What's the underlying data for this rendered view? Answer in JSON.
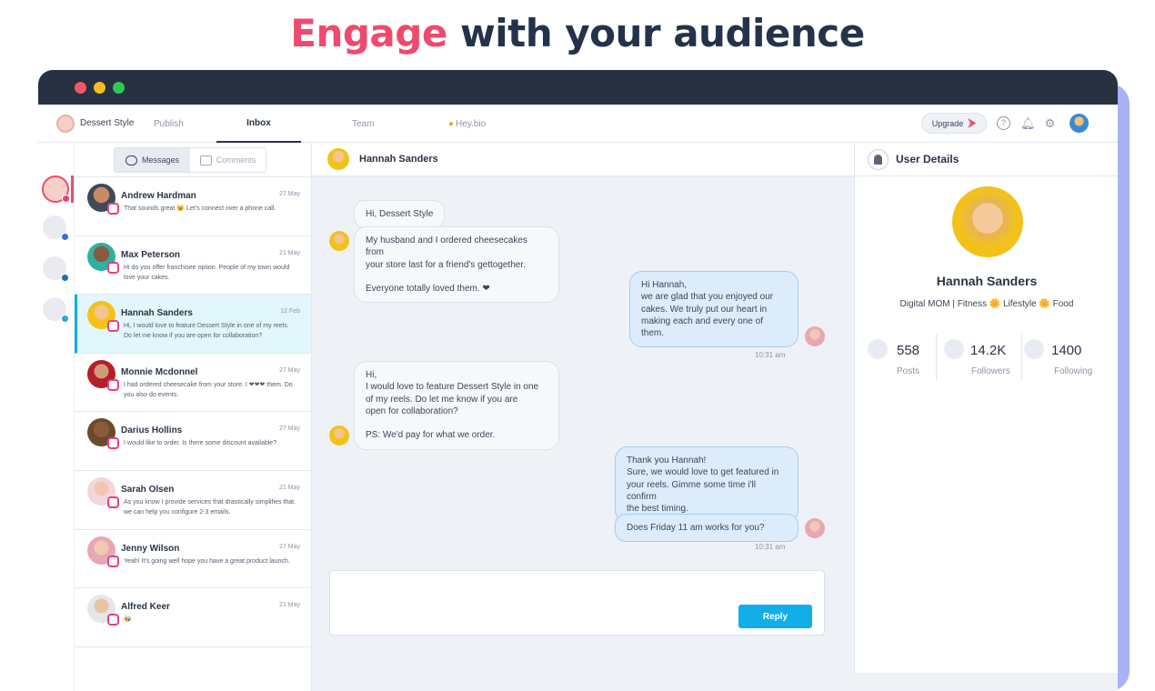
{
  "headline": {
    "accent": "Engage",
    "rest": "with your audience"
  },
  "colors": {
    "accent": "#ef4a6e",
    "brand_blue": "#11aee8",
    "dark": "#28313f"
  },
  "nav": {
    "brand": "Dessert Style",
    "items": [
      "Publish",
      "Inbox",
      "Team",
      "Hey.bio"
    ],
    "active": "Inbox",
    "upgrade": "Upgrade",
    "icons": [
      "help-icon",
      "bell-icon",
      "gear-icon"
    ]
  },
  "tabs": {
    "messages": "Messages",
    "comments": "Comments"
  },
  "conversations": [
    {
      "name": "Andrew Hardman",
      "date": "27 May",
      "preview": "That sounds great 😺 Let's connect over a phone call."
    },
    {
      "name": "Max Peterson",
      "date": "21 May",
      "preview": "Hi do you offer franchisee option. People of my town would love your cakes."
    },
    {
      "name": "Hannah Sanders",
      "date": "12 Feb",
      "preview": "Hi, I would love to feature Dessert Style in one of my reels. Do let me know if you are open for collaboration?"
    },
    {
      "name": "Monnie Mcdonnel",
      "date": "27 May",
      "preview": "I had ordered cheesecake from your store. I ❤❤❤ them. Do you also do events."
    },
    {
      "name": "Darius Hollins",
      "date": "27 May",
      "preview": "I would like to order. Is there some discount available?"
    },
    {
      "name": "Sarah Olsen",
      "date": "21 May",
      "preview": "As you know I provide services that drastically simplifies that. we can help you  configure 2-3 emails."
    },
    {
      "name": "Jenny Wilson",
      "date": "27 May",
      "preview": "Yeah! It's going well hope you have a great product launch."
    },
    {
      "name": "Alfred Keer",
      "date": "21 May",
      "preview": "🐝"
    }
  ],
  "chat": {
    "contact": "Hannah Sanders",
    "messages": [
      {
        "dir": "in",
        "text": "Hi, Dessert Style"
      },
      {
        "dir": "in",
        "text": "My husband and I ordered cheesecakes from\nyour store last for a friend's gettogether.\n\nEveryone totally loved them. ❤"
      },
      {
        "dir": "out",
        "text": "Hi Hannah,\nwe are glad that you enjoyed our\ncakes. We truly put our heart in\nmaking each and every one of them."
      },
      {
        "dir": "in",
        "text": "Hi,\nI would love to feature Dessert Style in one\nof my reels. Do let me know if you are\nopen for collaboration?\n\nPS: We'd pay for what we order."
      },
      {
        "dir": "out",
        "text": "Thank you Hannah!\nSure, we would love to get featured in\nyour reels. Gimme some time i'll confirm\nthe best timing."
      },
      {
        "dir": "out",
        "text": "Does Friday 11 am works for you?"
      }
    ],
    "time1": "10:31 am",
    "time2": "10:31 am",
    "reply_label": "Reply"
  },
  "details": {
    "title": "User Details",
    "name": "Hannah Sanders",
    "bio": "Digital MOM | Fitness 🌼 Lifestyle 🌼 Food",
    "stats": [
      {
        "value": "558",
        "label": "Posts"
      },
      {
        "value": "14.2K",
        "label": "Followers"
      },
      {
        "value": "1400",
        "label": "Following"
      }
    ]
  }
}
